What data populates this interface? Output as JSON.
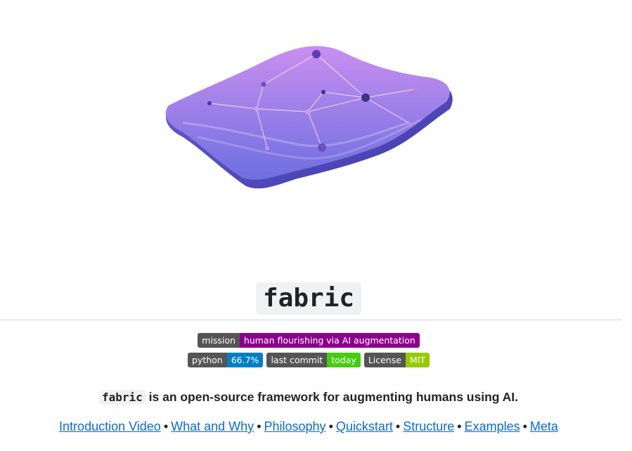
{
  "title": "fabric",
  "badges_row1": [
    {
      "label": "mission",
      "value": "human flourishing via AI augmentation",
      "value_color": "#8b008b"
    }
  ],
  "badges_row2": [
    {
      "label": "python",
      "value": "66.7%",
      "value_color": "#007ec6"
    },
    {
      "label": "last commit",
      "value": "today",
      "value_color": "#4c1"
    },
    {
      "label": "License",
      "value": "MIT",
      "value_color": "#97ca00"
    }
  ],
  "description": {
    "code": "fabric",
    "text": " is an open-source framework for augmenting humans using AI."
  },
  "nav_links": [
    "Introduction Video",
    "What and Why",
    "Philosophy",
    "Quickstart",
    "Structure",
    "Examples",
    "Meta"
  ],
  "nav_separator": "•",
  "logo_icon": "fabric-wave-logo-icon"
}
